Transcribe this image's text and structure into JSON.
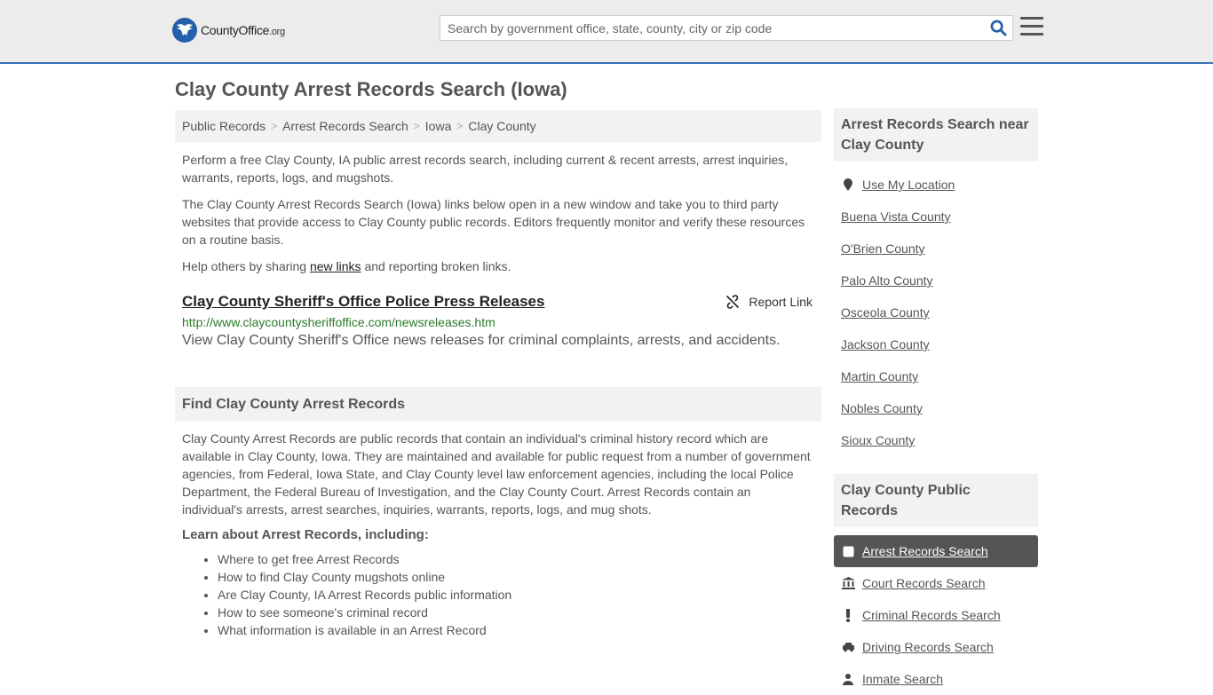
{
  "header": {
    "logo_brand": "CountyOffice",
    "logo_tld": ".org",
    "search_placeholder": "Search by government office, state, county, city or zip code"
  },
  "page_title": "Clay County Arrest Records Search (Iowa)",
  "breadcrumb": [
    "Public Records",
    "Arrest Records Search",
    "Iowa",
    "Clay County"
  ],
  "intro": {
    "p1": "Perform a free Clay County, IA public arrest records search, including current & recent arrests, arrest inquiries, warrants, reports, logs, and mugshots.",
    "p2": "The Clay County Arrest Records Search (Iowa) links below open in a new window and take you to third party websites that provide access to Clay County public records. Editors frequently monitor and verify these resources on a routine basis.",
    "p3_before": "Help others by sharing ",
    "p3_link": "new links",
    "p3_after": " and reporting broken links."
  },
  "result": {
    "title": "Clay County Sheriff's Office Police Press Releases",
    "report_label": "Report Link",
    "url": "http://www.claycountysheriffoffice.com/newsreleases.htm",
    "description": "View Clay County Sheriff's Office news releases for criminal complaints, arrests, and accidents."
  },
  "find_section": {
    "heading": "Find Clay County Arrest Records",
    "body": "Clay County Arrest Records are public records that contain an individual's criminal history record which are available in Clay County, Iowa. They are maintained and available for public request from a number of government agencies, from Federal, Iowa State, and Clay County level law enforcement agencies, including the local Police Department, the Federal Bureau of Investigation, and the Clay County Court. Arrest Records contain an individual's arrests, arrest searches, inquiries, warrants, reports, logs, and mug shots.",
    "learn_heading": "Learn about Arrest Records, including:",
    "learn_items": [
      "Where to get free Arrest Records",
      "How to find Clay County mugshots online",
      "Are Clay County, IA Arrest Records public information",
      "How to see someone's criminal record",
      "What information is available in an Arrest Record"
    ]
  },
  "sidebar": {
    "nearby_heading": "Arrest Records Search near Clay County",
    "use_location": "Use My Location",
    "nearby": [
      "Buena Vista County",
      "O'Brien County",
      "Palo Alto County",
      "Osceola County",
      "Jackson County",
      "Martin County",
      "Nobles County",
      "Sioux County"
    ],
    "records_heading": "Clay County Public Records",
    "records": [
      {
        "label": "Arrest Records Search",
        "icon": "square-icon"
      },
      {
        "label": "Court Records Search",
        "icon": "courthouse-icon"
      },
      {
        "label": "Criminal Records Search",
        "icon": "exclamation-icon"
      },
      {
        "label": "Driving Records Search",
        "icon": "car-icon"
      },
      {
        "label": "Inmate Search",
        "icon": "inmate-icon"
      }
    ]
  },
  "colors": {
    "accent": "#3b6fb6",
    "logo_blue": "#245fab",
    "url_green": "#2b7a2b",
    "active_bg": "#555555"
  }
}
